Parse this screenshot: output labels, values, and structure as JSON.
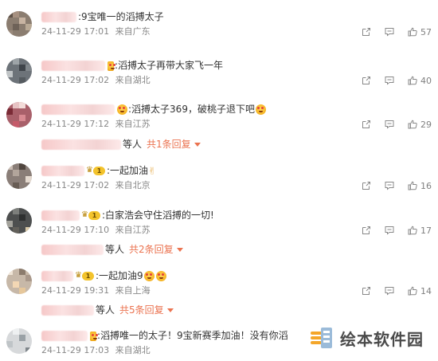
{
  "comments": [
    {
      "id": "c1",
      "text": ":9宝唯一的滔搏太子",
      "date": "24-11-29 17:01",
      "location": "来自广东",
      "likes": "57"
    },
    {
      "id": "c2",
      "text": ":滔搏太子再带大家飞一年",
      "date": "24-11-29 17:02",
      "location": "来自湖北",
      "likes": "40"
    },
    {
      "id": "c3",
      "text": ":滔搏太子369，破桃子退下吧",
      "date": "24-11-29 17:12",
      "location": "来自江苏",
      "likes": "29",
      "replies": {
        "label": "等人",
        "link": "共1条回复"
      }
    },
    {
      "id": "c4",
      "text": ":一起加油",
      "date": "24-11-29 17:02",
      "location": "来自北京",
      "likes": "16"
    },
    {
      "id": "c5",
      "text": ":白家浩会守住滔搏的一切!",
      "date": "24-11-29 17:10",
      "location": "来自江苏",
      "likes": "17",
      "replies": {
        "label": "等人",
        "link": "共2条回复"
      }
    },
    {
      "id": "c6",
      "text": ":一起加油9",
      "date": "24-11-29 19:31",
      "location": "来自上海",
      "likes": "14",
      "replies": {
        "label": "等人",
        "link": "共5条回复"
      }
    },
    {
      "id": "c7",
      "text": ":滔搏唯一的太子！9宝新赛季加油！没有你滔",
      "date": "24-11-29 17:03",
      "location": "来自湖北"
    }
  ],
  "badge_level": "1",
  "watermark": {
    "text": "绘本软件园"
  },
  "colors": {
    "accent": "#eb7350",
    "meta": "#888888",
    "text": "#333333"
  }
}
